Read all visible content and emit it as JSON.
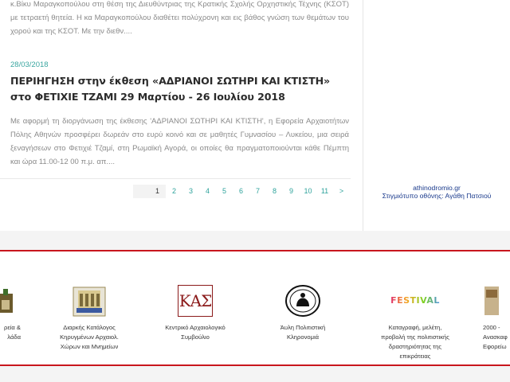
{
  "previous_excerpt": "κ.Βίκυ Μαραγκοπούλου στη θέση της Διευθύντριας της Κρατικής Σχολής Ορχηστικής Τέχνης (ΚΣΟΤ) με τετραετή θητεία. Η κα Μαραγκοπούλου διαθέτει πολύχρονη και εις βάθος γνώση των θεμάτων του χορού και της ΚΣΟΤ. Με την διεθν....",
  "article": {
    "date": "28/03/2018",
    "title": "ΠΕΡΙΗΓΗΣΗ στην έκθεση «ΑΔΡΙΑΝΟΙ ΣΩΤΗΡΙ ΚΑΙ ΚΤΙΣΤΗ» στο ΦΕΤΙΧΙΕ ΤΖΑΜΙ 29 Μαρτίου - 26 Ιουλίου 2018",
    "excerpt": "Με αφορμή τη διοργάνωση της έκθεσης 'ΑΔΡΙΑΝΟΙ ΣΩΤΗΡΙ ΚΑΙ ΚΤΙΣΤΗ', η Εφορεία Αρχαιοτήτων Πόλης Αθηνών προσφέρει δωρεάν στο ευρύ κοινό και σε μαθητές Γυμνασίου – Λυκείου, μια σειρά ξεναγήσεων στο Φετιχιέ Τζαμί, στη Ρωμαϊκή Αγορά, οι οποίες θα πραγματοποιούνται κάθε Πέμπτη και ώρα 11.00-12 00 π.μ. απ...."
  },
  "pagination": {
    "pages": [
      "1",
      "2",
      "3",
      "4",
      "5",
      "6",
      "7",
      "8",
      "9",
      "10",
      "11"
    ],
    "next": ">",
    "current": "1"
  },
  "sidebar": {
    "credit_site": "athinodromio.gr",
    "credit_line": "Στιγμιότυπο οθόνης: Αγάθη Πατσιού"
  },
  "partners": [
    {
      "label": "ρεία &\nλάδα",
      "icon": "ministry-logo-icon"
    },
    {
      "label": "Διαρκής Κατάλογος\nΚηρυγμένων Αρχαιολ.\nΧώρων και Μνημείων",
      "icon": "monuments-catalogue-icon"
    },
    {
      "label": "Κεντρικό Αρχαιολογικό\nΣυμβούλιο",
      "icon": "kas-logo-icon",
      "logo_text": "ΚΑΣ"
    },
    {
      "label": "Άυλη Πολιτιστική\nΚληρονομιά",
      "icon": "intangible-heritage-icon"
    },
    {
      "label": "Καταγραφή, μελέτη,\nπροβολή της πολιτιστικής\nδραστηριότητας της\nεπικράτειας",
      "icon": "festival-logo-icon",
      "logo_text": "FESTIVAL"
    },
    {
      "label": "2000 -\nΑνασκαφ\nΕφορείω",
      "icon": "excavations-icon"
    }
  ],
  "colors": {
    "accent": "#2fa39c",
    "border_red": "#c8161d",
    "credit_blue": "#1a3a8c"
  }
}
